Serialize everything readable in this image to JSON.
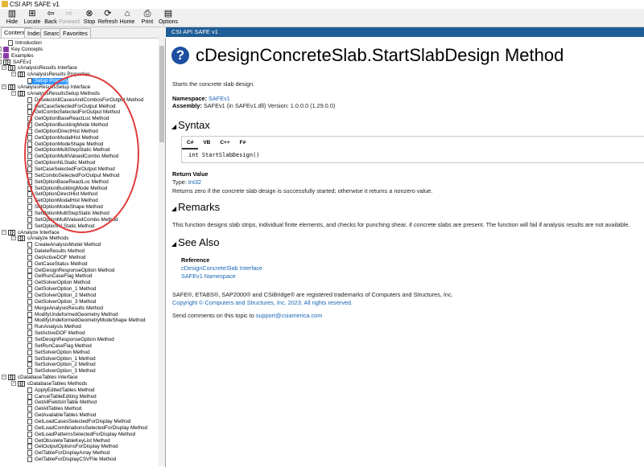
{
  "window": {
    "title": "CSI API SAFE v1"
  },
  "toolbar": [
    {
      "label": "Hide",
      "icon": "hide-icon",
      "glyph": "▥",
      "enabled": true
    },
    {
      "label": "Locate",
      "icon": "locate-icon",
      "glyph": "⊞",
      "enabled": true
    },
    {
      "label": "Back",
      "icon": "back-icon",
      "glyph": "⇦",
      "enabled": true
    },
    {
      "label": "Forward",
      "icon": "forward-icon",
      "glyph": "⇨",
      "enabled": false
    },
    {
      "label": "Stop",
      "icon": "stop-icon",
      "glyph": "⊗",
      "enabled": true
    },
    {
      "label": "Refresh",
      "icon": "refresh-icon",
      "glyph": "⟳",
      "enabled": true
    },
    {
      "label": "Home",
      "icon": "home-icon",
      "glyph": "⌂",
      "enabled": true
    },
    {
      "label": "Print",
      "icon": "print-icon",
      "glyph": "⎙",
      "enabled": true
    },
    {
      "label": "Options",
      "icon": "options-icon",
      "glyph": "▤",
      "enabled": true
    }
  ],
  "tabs": [
    {
      "label": "Contents",
      "active": true
    },
    {
      "label": "Index",
      "active": false
    },
    {
      "label": "Search",
      "active": false
    },
    {
      "label": "Favorites",
      "active": false
    }
  ],
  "tree": [
    {
      "t": "Introduction",
      "lvl": 1,
      "icon": "page"
    },
    {
      "t": "Key Concepts",
      "lvl": 0,
      "icon": "book",
      "exp": "+"
    },
    {
      "t": "Examples",
      "lvl": 0,
      "icon": "book",
      "exp": "+"
    },
    {
      "t": "SAFEv1",
      "lvl": 0,
      "icon": "class",
      "exp": "−"
    },
    {
      "t": "cAnalysisResults Interface",
      "lvl": 1,
      "icon": "class",
      "exp": "−"
    },
    {
      "t": "cAnalysisResults Properties",
      "lvl": 2,
      "icon": "class",
      "exp": "−"
    },
    {
      "t": "Setup Property",
      "lvl": 3,
      "icon": "page"
    },
    {
      "t": "cAnalysisResultsSetup Interface",
      "lvl": 1,
      "icon": "class",
      "exp": "−"
    },
    {
      "t": "cAnalysisResultsSetup Methods",
      "lvl": 2,
      "icon": "class",
      "exp": "−"
    },
    {
      "t": "DeselectAllCasesAndCombosForOutput Method",
      "lvl": 3,
      "icon": "page"
    },
    {
      "t": "GetCaseSelectedForOutput Method",
      "lvl": 3,
      "icon": "page"
    },
    {
      "t": "GetComboSelectedForOutput Method",
      "lvl": 3,
      "icon": "page"
    },
    {
      "t": "GetOptionBaseReactLoc Method",
      "lvl": 3,
      "icon": "page"
    },
    {
      "t": "GetOptionBucklingMode Method",
      "lvl": 3,
      "icon": "page"
    },
    {
      "t": "GetOptionDirectHist Method",
      "lvl": 3,
      "icon": "page"
    },
    {
      "t": "GetOptionModalHist Method",
      "lvl": 3,
      "icon": "page"
    },
    {
      "t": "GetOptionModeShape Method",
      "lvl": 3,
      "icon": "page"
    },
    {
      "t": "GetOptionMultiStepStatic Method",
      "lvl": 3,
      "icon": "page"
    },
    {
      "t": "GetOptionMultiValuedCombo Method",
      "lvl": 3,
      "icon": "page"
    },
    {
      "t": "GetOptionNLStatic Method",
      "lvl": 3,
      "icon": "page"
    },
    {
      "t": "SetCaseSelectedForOutput Method",
      "lvl": 3,
      "icon": "page"
    },
    {
      "t": "SetComboSelectedForOutput Method",
      "lvl": 3,
      "icon": "page"
    },
    {
      "t": "SetOptionBaseReactLoc Method",
      "lvl": 3,
      "icon": "page"
    },
    {
      "t": "SetOptionBucklingMode Method",
      "lvl": 3,
      "icon": "page"
    },
    {
      "t": "SetOptionDirectHist Method",
      "lvl": 3,
      "icon": "page"
    },
    {
      "t": "SetOptionModalHist Method",
      "lvl": 3,
      "icon": "page"
    },
    {
      "t": "SetOptionModeShape Method",
      "lvl": 3,
      "icon": "page"
    },
    {
      "t": "SetOptionMultiStepStatic Method",
      "lvl": 3,
      "icon": "page"
    },
    {
      "t": "SetOptionMultiValuedCombo Method",
      "lvl": 3,
      "icon": "page"
    },
    {
      "t": "SetOptionNLStatic Method",
      "lvl": 3,
      "icon": "page"
    },
    {
      "t": "cAnalyze Interface",
      "lvl": 1,
      "icon": "class",
      "exp": "−"
    },
    {
      "t": "cAnalyze Methods",
      "lvl": 2,
      "icon": "class",
      "exp": "−"
    },
    {
      "t": "CreateAnalysisModel Method",
      "lvl": 3,
      "icon": "page"
    },
    {
      "t": "DeleteResults Method",
      "lvl": 3,
      "icon": "page"
    },
    {
      "t": "GetActiveDOF Method",
      "lvl": 3,
      "icon": "page"
    },
    {
      "t": "GetCaseStatus Method",
      "lvl": 3,
      "icon": "page"
    },
    {
      "t": "GetDesignResponseOption Method",
      "lvl": 3,
      "icon": "page"
    },
    {
      "t": "GetRunCaseFlag Method",
      "lvl": 3,
      "icon": "page"
    },
    {
      "t": "GetSolverOption Method",
      "lvl": 3,
      "icon": "page"
    },
    {
      "t": "GetSolverOption_1 Method",
      "lvl": 3,
      "icon": "page"
    },
    {
      "t": "GetSolverOption_2 Method",
      "lvl": 3,
      "icon": "page"
    },
    {
      "t": "GetSolverOption_3 Method",
      "lvl": 3,
      "icon": "page"
    },
    {
      "t": "MergeAnalysisResults Method",
      "lvl": 3,
      "icon": "page"
    },
    {
      "t": "ModifyUndeformedGeometry Method",
      "lvl": 3,
      "icon": "page"
    },
    {
      "t": "ModifyUndeformedGeometryModeShape Method",
      "lvl": 3,
      "icon": "page"
    },
    {
      "t": "RunAnalysis Method",
      "lvl": 3,
      "icon": "page"
    },
    {
      "t": "SetActiveDOF Method",
      "lvl": 3,
      "icon": "page"
    },
    {
      "t": "SetDesignResponseOption Method",
      "lvl": 3,
      "icon": "page"
    },
    {
      "t": "SetRunCaseFlag Method",
      "lvl": 3,
      "icon": "page"
    },
    {
      "t": "SetSolverOption Method",
      "lvl": 3,
      "icon": "page"
    },
    {
      "t": "SetSolverOption_1 Method",
      "lvl": 3,
      "icon": "page"
    },
    {
      "t": "SetSolverOption_2 Method",
      "lvl": 3,
      "icon": "page"
    },
    {
      "t": "SetSolverOption_3 Method",
      "lvl": 3,
      "icon": "page"
    },
    {
      "t": "cDatabaseTables Interface",
      "lvl": 1,
      "icon": "class",
      "exp": "−"
    },
    {
      "t": "cDatabaseTables Methods",
      "lvl": 2,
      "icon": "class",
      "exp": "−"
    },
    {
      "t": "ApplyEditedTables Method",
      "lvl": 3,
      "icon": "page"
    },
    {
      "t": "CancelTableEditing Method",
      "lvl": 3,
      "icon": "page"
    },
    {
      "t": "GetAllFieldsInTable Method",
      "lvl": 3,
      "icon": "page"
    },
    {
      "t": "GetAllTables Method",
      "lvl": 3,
      "icon": "page"
    },
    {
      "t": "GetAvailableTables Method",
      "lvl": 3,
      "icon": "page"
    },
    {
      "t": "GetLoadCasesSelectedForDisplay Method",
      "lvl": 3,
      "icon": "page"
    },
    {
      "t": "GetLoadCombinationsSelectedForDisplay Method",
      "lvl": 3,
      "icon": "page"
    },
    {
      "t": "GetLoadPatternsSelectedForDisplay Method",
      "lvl": 3,
      "icon": "page"
    },
    {
      "t": "GetObsoleteTableKeyList Method",
      "lvl": 3,
      "icon": "page"
    },
    {
      "t": "GetOutputOptionsForDisplay Method",
      "lvl": 3,
      "icon": "page"
    },
    {
      "t": "GetTableForDisplayArray Method",
      "lvl": 3,
      "icon": "page"
    },
    {
      "t": "GetTableForDisplayCSVFile Method",
      "lvl": 3,
      "icon": "page"
    }
  ],
  "content": {
    "header": "CSI API SAFE v1",
    "title": "cDesignConcreteSlab.StartSlabDesign Method",
    "summary": "Starts the concrete slab design.",
    "namespace_label": "Namespace:",
    "namespace_value": "SAFEv1",
    "assembly_label": "Assembly:",
    "assembly_value": "SAFEv1 (in SAFEv1.dll) Version: 1.0.0.0 (1.29.0.0)",
    "syntax_heading": "Syntax",
    "code_tabs": [
      "C#",
      "VB",
      "C++",
      "F#"
    ],
    "code": "int StartSlabDesign()",
    "return_heading": "Return Value",
    "return_type_label": "Type:",
    "return_type_value": "Int32",
    "return_desc": "Returns zero if the concrete slab design is successfully started; otherwise it returns a nonzero value.",
    "remarks_heading": "Remarks",
    "remarks_text": "This function designs slab strips, individual finite elements, and checks for punching shear, if concrete slabs are present. The function will fail if analysis results are not available.",
    "see_also_heading": "See Also",
    "reference_heading": "Reference",
    "ref_link1": "cDesignConcreteSlab Interface",
    "ref_link2": "SAFEv1 Namespace",
    "trademark": "SAFE®, ETABS®, SAP2000® and CSiBridge® are registered trademarks of Computers and Structures, Inc.",
    "copyright": "Copyright © Computers and Structures, Inc. 2023. All rights reserved.",
    "feedback_prefix": "Send comments on this topic to",
    "feedback_link": "support@csiamerica.com"
  },
  "colors": {
    "header_bg": "#1f5d96",
    "link": "#1a66b5",
    "annotation": "#e03c3c",
    "selection": "#3399ff"
  }
}
